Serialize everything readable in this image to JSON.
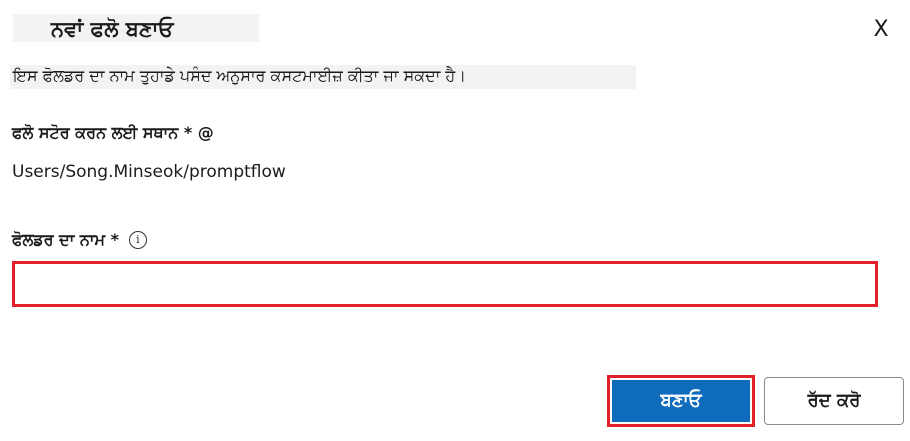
{
  "dialog": {
    "title": "ਨਵਾਂ ਫਲੋ ਬਣਾਓ",
    "close_label": "X",
    "description": "ਇਸ ਫੋਲਡਰ ਦਾ ਨਾਮ ਤੁਹਾਡੇ ਪਸੰਦ ਅਨੁਸਾਰ ਕਸਟਮਾਈਜ਼ ਕੀਤਾ ਜਾ ਸਕਦਾ ਹੈ।",
    "location_label": "ਫਲੋ ਸਟੋਰ ਕਰਨ ਲਈ ਸਥਾਨ * @",
    "location_value": "Users/Song.Minseok/promptflow",
    "folder_name_label": "ਫੋਲਡਰ ਦਾ ਨਾਮ *",
    "info_icon": "i",
    "folder_name_value": "",
    "create_label": "ਬਣਾਓ",
    "cancel_label": "ਰੱਦ ਕਰੋ"
  },
  "colors": {
    "primary": "#0f6cbd",
    "highlight": "#e0212b"
  }
}
